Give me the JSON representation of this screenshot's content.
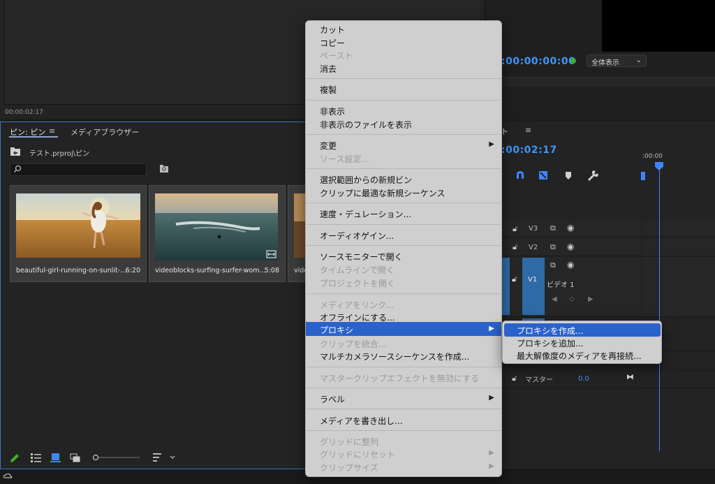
{
  "source_monitor": {
    "timecode": "00:00:02:17"
  },
  "program_monitor": {
    "timecode": ":00:00:00:00",
    "zoom": "全体表示"
  },
  "bin_panel": {
    "tab_bin": "ピン: ピン",
    "tab_menu": "≡",
    "tab_media_browser": "メディアブラウザー",
    "path": "テスト.prproj\\ピン",
    "clips": [
      {
        "name": "beautiful-girl-running-on-sunlit-...",
        "duration": "6:20"
      },
      {
        "name": "videoblocks-surfing-surfer-wom...",
        "duration": "5:08"
      },
      {
        "name": "vide",
        "duration": ""
      }
    ]
  },
  "timeline": {
    "title": "スト",
    "menu": "≡",
    "timecode": ":00:02:17",
    "ruler_label": ":00:00",
    "tracks": [
      {
        "label": "V3"
      },
      {
        "label": "V2"
      },
      {
        "label": "V1",
        "sublabel": "ビデオ 1"
      },
      {
        "label": "マスター",
        "value": "0.0"
      }
    ]
  },
  "context_menu": {
    "items": [
      {
        "label": "カット",
        "disabled": false
      },
      {
        "label": "コピー",
        "disabled": false
      },
      {
        "label": "ペースト",
        "disabled": true
      },
      {
        "label": "消去",
        "disabled": false
      },
      {
        "label": "複製",
        "disabled": false
      },
      {
        "label": "非表示",
        "disabled": false
      },
      {
        "label": "非表示のファイルを表示",
        "disabled": false
      },
      {
        "label": "変更",
        "disabled": false,
        "submenu": true
      },
      {
        "label": "ソース設定...",
        "disabled": true
      },
      {
        "label": "選択範囲からの新規ビン",
        "disabled": false
      },
      {
        "label": "クリップに最適な新規シーケンス",
        "disabled": false
      },
      {
        "label": "速度・デュレーション...",
        "disabled": false
      },
      {
        "label": "オーディオゲイン...",
        "disabled": false
      },
      {
        "label": "ソースモニターで開く",
        "disabled": false
      },
      {
        "label": "タイムラインで開く",
        "disabled": true
      },
      {
        "label": "プロジェクトを開く",
        "disabled": true
      },
      {
        "label": "メディアをリンク...",
        "disabled": true
      },
      {
        "label": "オフラインにする...",
        "disabled": false
      },
      {
        "label": "プロキシ",
        "disabled": false,
        "submenu": true,
        "highlighted": true
      },
      {
        "label": "クリップを統合...",
        "disabled": true
      },
      {
        "label": "マルチカメラソースシーケンスを作成...",
        "disabled": false
      },
      {
        "label": "マスタークリップエフェクトを無効にする",
        "disabled": true
      },
      {
        "label": "ラベル",
        "disabled": false,
        "submenu": true
      },
      {
        "label": "メディアを書き出し...",
        "disabled": false
      },
      {
        "label": "グリッドに整列",
        "disabled": true
      },
      {
        "label": "グリッドにリセット",
        "disabled": true,
        "submenu": true
      },
      {
        "label": "クリップサイズ",
        "disabled": true,
        "submenu": true
      }
    ]
  },
  "proxy_submenu": {
    "items": [
      {
        "label": "プロキシを作成...",
        "highlighted": true
      },
      {
        "label": "プロキシを追加...",
        "highlighted": false
      },
      {
        "label": "最大解像度のメディアを再接続...",
        "highlighted": false
      }
    ]
  },
  "colors": {
    "accent": "#3d96ff",
    "highlight": "#2a62cc",
    "panel": "#232323"
  }
}
